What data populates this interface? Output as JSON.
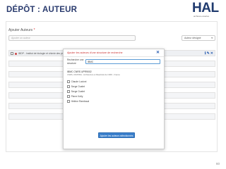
{
  "slide": {
    "title": "DÉPÔT : AUTEUR",
    "logo_text": "HAL",
    "logo_subtitle": "archives-ouvertes",
    "page_number": "60"
  },
  "background_form": {
    "label": "Ajouter Auteurs",
    "required_mark": "*",
    "search_placeholder": "Ajouter un auteur",
    "role_select_value": "Auteur désigné",
    "row_text": "IBDP - Institut de biologie et chimie des protéines",
    "row_icons": [
      "ℹ",
      "✎",
      "✕"
    ]
  },
  "modal": {
    "title": "Ajouter les auteurs d'une structure de recherche",
    "close_glyph": "✕",
    "search_label": "Rechercher une structure",
    "search_value": "IBMC",
    "structure_name": "IBMC CNRS UPR9002",
    "structure_subtitle": "CNRS, UNISTRA - Architecture et Réactivité de l'ARN - France",
    "authors": [
      "Claude Lucioni",
      "Serge Ouelet",
      "Serge Ouelet",
      "Pierre Kelly",
      "Hélène Rambaud"
    ],
    "add_button_label": "Ajouter les auteurs sélectionnés"
  },
  "colors": {
    "title": "#2a3b6e",
    "modal_title": "#cc3333",
    "button": "#3a7fcb",
    "focus_border": "#5b9bd5"
  }
}
